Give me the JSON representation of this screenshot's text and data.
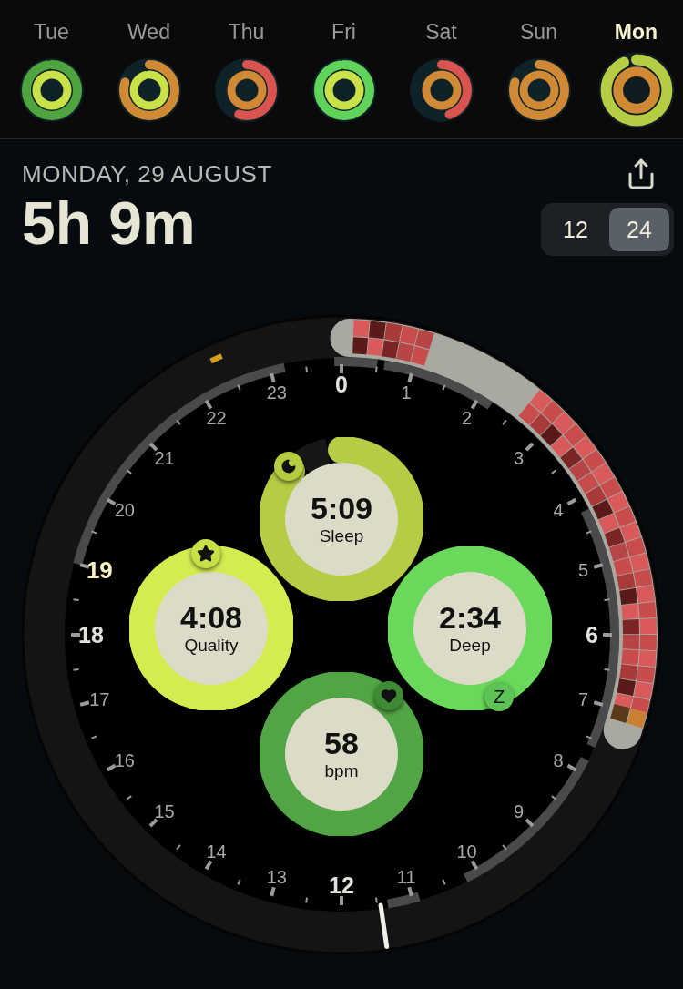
{
  "days": [
    {
      "label": "Tue",
      "selected": false,
      "rings": [
        {
          "color": "#4fa43f",
          "level": 0.97
        },
        {
          "color": "#c9e24a",
          "level": 0.96
        }
      ]
    },
    {
      "label": "Wed",
      "selected": false,
      "rings": [
        {
          "color": "#d08a35",
          "level": 0.8
        },
        {
          "color": "#c9e24a",
          "level": 0.95
        }
      ]
    },
    {
      "label": "Thu",
      "selected": false,
      "rings": [
        {
          "color": "#d9534f",
          "level": 0.55
        },
        {
          "color": "#d08a35",
          "level": 0.97
        }
      ]
    },
    {
      "label": "Fri",
      "selected": false,
      "rings": [
        {
          "color": "#5fd35a",
          "level": 0.97
        },
        {
          "color": "#c9e24a",
          "level": 0.96
        }
      ]
    },
    {
      "label": "Sat",
      "selected": false,
      "rings": [
        {
          "color": "#d9534f",
          "level": 0.45
        },
        {
          "color": "#d08a35",
          "level": 1
        }
      ]
    },
    {
      "label": "Sun",
      "selected": false,
      "rings": [
        {
          "color": "#d08a35",
          "level": 0.8
        },
        {
          "color": "#d08a35",
          "level": 0.97
        }
      ]
    },
    {
      "label": "Mon",
      "selected": true,
      "rings": [
        {
          "color": "#b5cd45",
          "level": 0.93
        },
        {
          "color": "#d08a35",
          "level": 1
        }
      ]
    }
  ],
  "date": "MONDAY, 29 AUGUST",
  "total": "5h 9m",
  "clock_format": [
    {
      "label": "12",
      "selected": false
    },
    {
      "label": "24",
      "selected": true
    }
  ],
  "hours_right": [
    {
      "label": "0",
      "kind": "major"
    },
    {
      "label": "1",
      "kind": "minor"
    },
    {
      "label": "2",
      "kind": "minor"
    },
    {
      "label": "3",
      "kind": "minor"
    },
    {
      "label": "4",
      "kind": "minor"
    },
    {
      "label": "5",
      "kind": "minor"
    },
    {
      "label": "6",
      "kind": "major"
    },
    {
      "label": "7",
      "kind": "minor"
    },
    {
      "label": "8",
      "kind": "minor"
    },
    {
      "label": "9",
      "kind": "minor"
    },
    {
      "label": "10",
      "kind": "minor"
    },
    {
      "label": "11",
      "kind": "minor"
    },
    {
      "label": "12",
      "kind": "major"
    }
  ],
  "hours_left": [
    {
      "label": "23",
      "kind": "minor"
    },
    {
      "label": "22",
      "kind": "minor"
    },
    {
      "label": "21",
      "kind": "minor"
    },
    {
      "label": "20",
      "kind": "minor"
    },
    {
      "label": "19",
      "kind": "current"
    },
    {
      "label": "18",
      "kind": "major"
    },
    {
      "label": "17",
      "kind": "minor"
    },
    {
      "label": "16",
      "kind": "minor"
    },
    {
      "label": "15",
      "kind": "minor"
    },
    {
      "label": "14",
      "kind": "minor"
    },
    {
      "label": "13",
      "kind": "minor"
    }
  ],
  "metrics": [
    {
      "kind": "sleep",
      "value": "5:09",
      "label": "Sleep",
      "color": "#b5cd45",
      "level": 0.87
    },
    {
      "kind": "quality",
      "value": "4:08",
      "label": "Quality",
      "color": "#d4ec50",
      "level": 1
    },
    {
      "kind": "deep",
      "value": "2:34",
      "label": "Deep",
      "color": "#69d85b",
      "level": 1,
      "badge_text": "Z"
    },
    {
      "kind": "heart_rate",
      "value": "58",
      "label": "bpm",
      "color": "#52a545",
      "level": 1
    }
  ]
}
